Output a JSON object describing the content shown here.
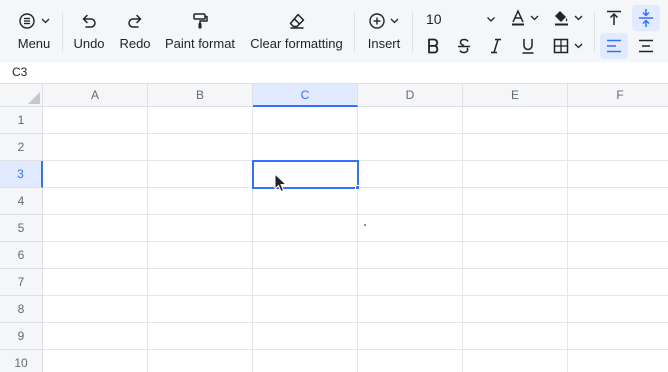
{
  "toolbar": {
    "menu_label": "Menu",
    "undo_label": "Undo",
    "redo_label": "Redo",
    "paint_format_label": "Paint format",
    "clear_formatting_label": "Clear formatting",
    "insert_label": "Insert",
    "font_size": "10",
    "icons": {
      "menu": "menu-circle-icon",
      "undo": "undo-icon",
      "redo": "redo-icon",
      "paint_format": "paint-roller-icon",
      "clear_formatting": "eraser-icon",
      "insert": "plus-circle-icon",
      "font_color": "font-color-icon",
      "fill_color": "fill-bucket-icon",
      "align_top": "align-top-icon",
      "align_middle": "align-vertical-center-icon",
      "bold": "bold-icon",
      "strikethrough": "strikethrough-icon",
      "italic": "italic-icon",
      "underline": "underline-icon",
      "borders": "borders-icon",
      "align_left": "align-left-icon",
      "align_center": "align-center-icon"
    }
  },
  "namebar": {
    "cell_ref": "C3"
  },
  "grid": {
    "columns": [
      "A",
      "B",
      "C",
      "D",
      "E",
      "F"
    ],
    "rows": [
      "1",
      "2",
      "3",
      "4",
      "5",
      "6",
      "7",
      "8",
      "9",
      "10"
    ],
    "selected_cell": "C3"
  },
  "colors": {
    "accent": "#3370ff",
    "accent_bg": "#e1eaff",
    "toolbar_bg": "#f5f6f7"
  }
}
